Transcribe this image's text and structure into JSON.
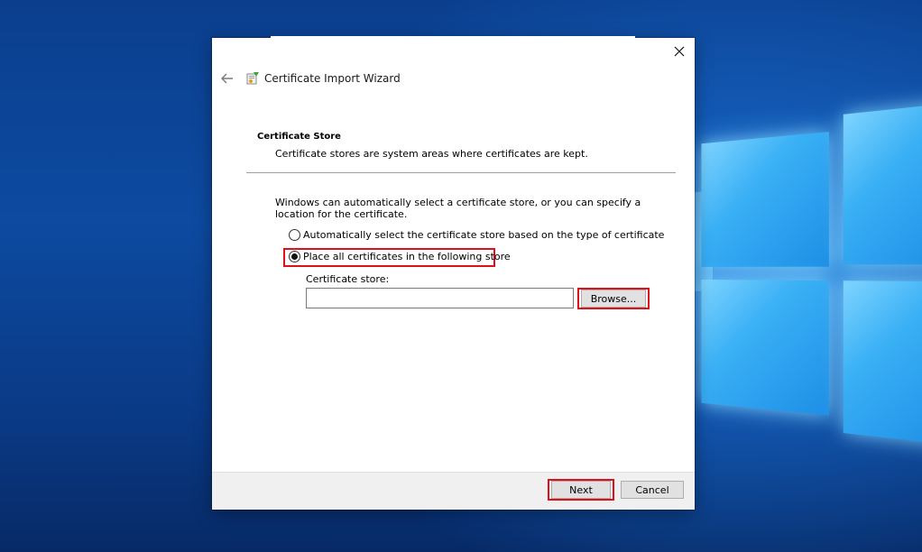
{
  "dialog": {
    "title": "Certificate Import Wizard",
    "close_icon": "close-icon",
    "back_icon": "back-arrow-icon",
    "wizard_icon": "certificate-wizard-icon"
  },
  "section": {
    "heading": "Certificate Store",
    "description": "Certificate stores are system areas where certificates are kept."
  },
  "intro_text": "Windows can automatically select a certificate store, or you can specify a location for the certificate.",
  "options": {
    "auto_label": "Automatically select the certificate store based on the type of certificate",
    "auto_selected": false,
    "place_label": "Place all certificates in the following store",
    "place_selected": true
  },
  "store": {
    "label": "Certificate store:",
    "value": "",
    "browse_label": "Browse..."
  },
  "footer": {
    "next_label": "Next",
    "cancel_label": "Cancel"
  },
  "colors": {
    "highlight": "#e0101a",
    "desktop_blue": "#0b3f8e",
    "footer_bg": "#f0f0f0"
  }
}
